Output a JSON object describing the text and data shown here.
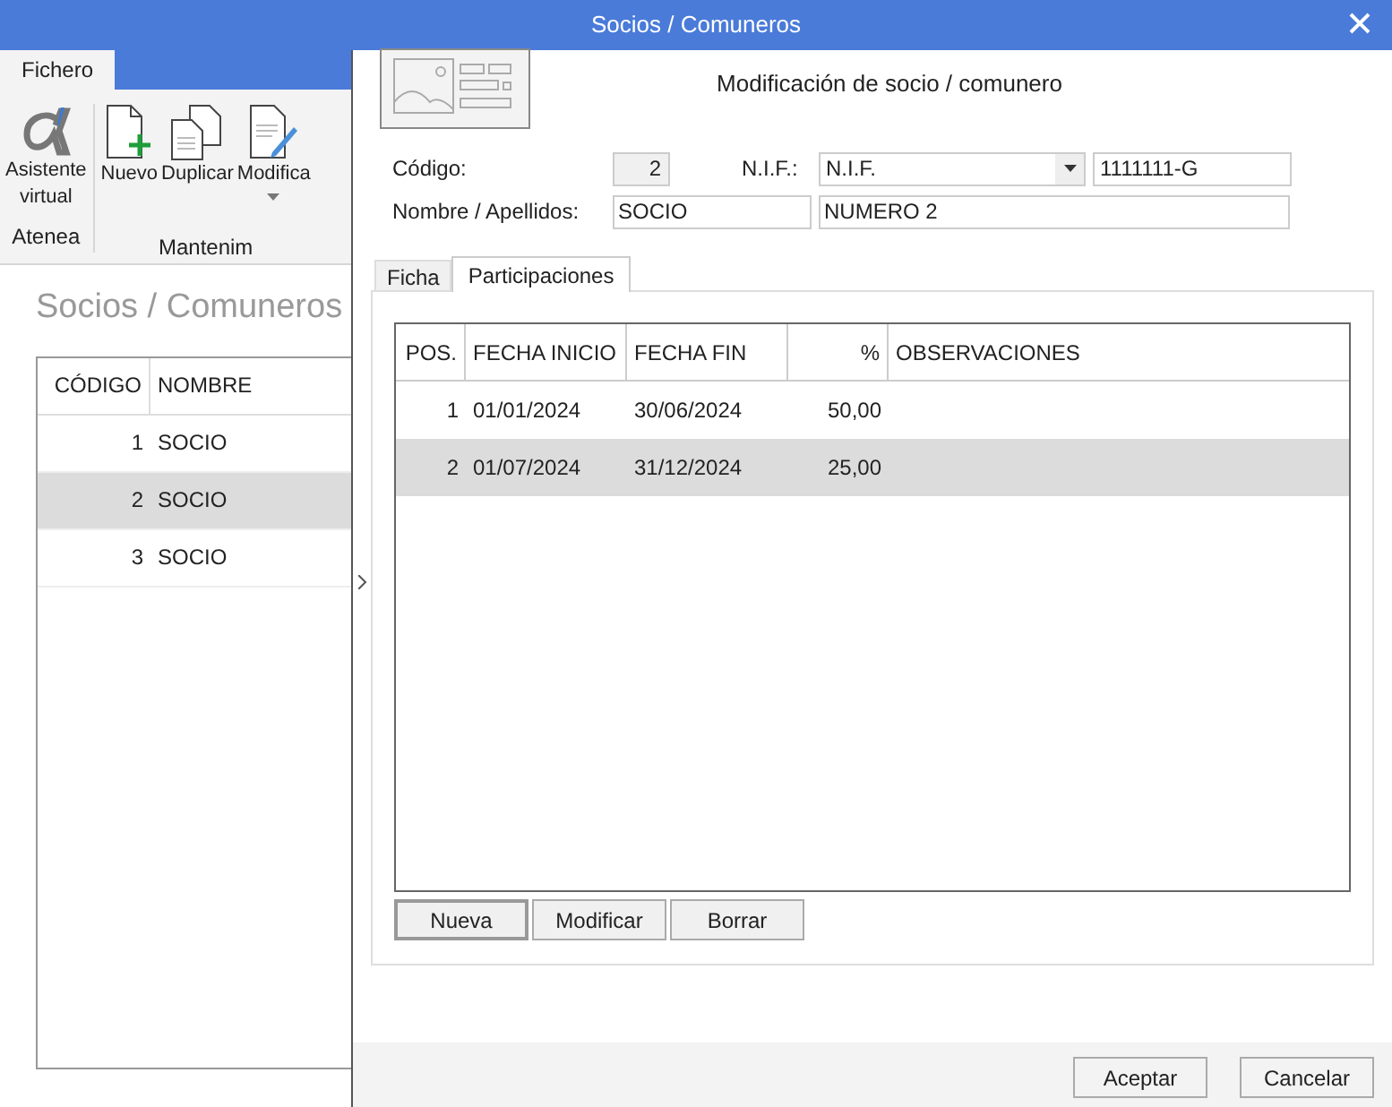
{
  "window": {
    "title": "Socios / Comuneros"
  },
  "background_app": {
    "ribbon_tabs": [
      {
        "label": "Fichero",
        "selected": true
      }
    ],
    "ribbon_groups": [
      {
        "label": "Atenea",
        "buttons": [
          {
            "kind": "alpha",
            "lines": [
              "Asistente",
              "virtual"
            ]
          }
        ]
      },
      {
        "label": "Mantenim",
        "buttons": [
          {
            "kind": "new",
            "lines": [
              "Nuevo"
            ]
          },
          {
            "kind": "duplicate",
            "lines": [
              "Duplicar"
            ]
          },
          {
            "kind": "edit",
            "lines": [
              "Modifica"
            ],
            "dropdown": true
          }
        ]
      }
    ],
    "heading": "Socios / Comuneros",
    "table": {
      "columns": [
        "CÓDIGO",
        "NOMBRE"
      ],
      "rows": [
        {
          "cells": [
            "1",
            "SOCIO"
          ],
          "selected": false
        },
        {
          "cells": [
            "2",
            "SOCIO"
          ],
          "selected": true
        },
        {
          "cells": [
            "3",
            "SOCIO"
          ],
          "selected": false
        }
      ]
    }
  },
  "dialog": {
    "title": "Modificación de socio / comunero",
    "codigo_label": "Código:",
    "codigo_value": "2",
    "nif_label": "N.I.F.:",
    "nif_type": "N.I.F.",
    "nif_value": "1111111-G",
    "nombre_label": "Nombre / Apellidos:",
    "nombre_value": "SOCIO",
    "apellidos_value": "NUMERO 2",
    "tabs": [
      {
        "label": "Ficha",
        "selected": false
      },
      {
        "label": "Participaciones",
        "selected": true
      }
    ],
    "grid": {
      "columns": [
        "POS.",
        "FECHA INICIO",
        "FECHA FIN",
        "%",
        "OBSERVACIONES"
      ],
      "rows": [
        {
          "cells": [
            "1",
            "01/01/2024",
            "30/06/2024",
            "50,00",
            ""
          ],
          "selected": false
        },
        {
          "cells": [
            "2",
            "01/07/2024",
            "31/12/2024",
            "25,00",
            ""
          ],
          "selected": true
        }
      ]
    },
    "grid_buttons": [
      {
        "label": "Nueva",
        "default": true
      },
      {
        "label": "Modificar",
        "default": false
      },
      {
        "label": "Borrar",
        "default": false
      }
    ],
    "footer_buttons": [
      "Aceptar",
      "Cancelar"
    ]
  }
}
